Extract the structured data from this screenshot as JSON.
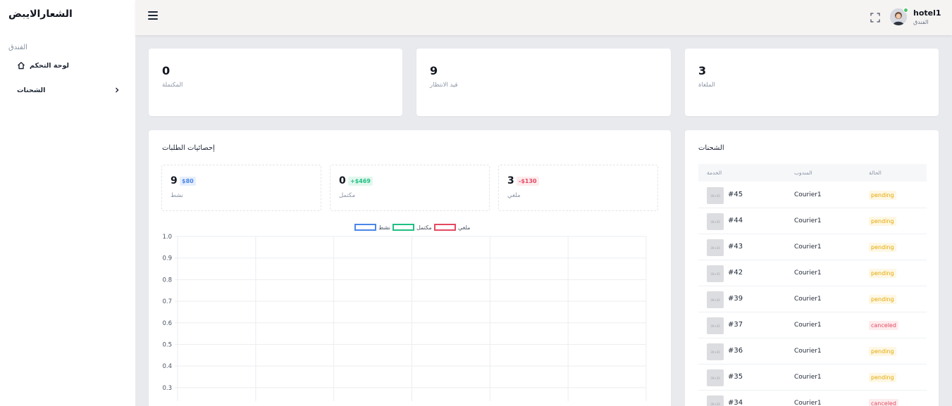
{
  "app": {
    "brand": "الشعارالايبض"
  },
  "sidebar": {
    "section_label": "الفندق",
    "items": [
      {
        "label": "لوحة التحكم",
        "icon": "home-icon"
      },
      {
        "label": "الشحنات",
        "icon": "chevron-right-icon"
      }
    ]
  },
  "header": {
    "user_name": "hotel1",
    "user_role": "الفندق"
  },
  "stats": [
    {
      "value": "0",
      "label": "المكتملة"
    },
    {
      "value": "9",
      "label": "قيد الانتظار"
    },
    {
      "value": "3",
      "label": "الملغاة"
    }
  ],
  "orders_panel": {
    "title": "إحصائيات الطلبات",
    "summary": [
      {
        "value": "9",
        "badge": "$80",
        "label": "نشط",
        "color": "#4a86e8"
      },
      {
        "value": "0",
        "badge": "+$469",
        "label": "مكتمل",
        "color": "#1fbf83"
      },
      {
        "value": "3",
        "badge": "-$130",
        "label": "ملغي",
        "color": "#e44961"
      }
    ]
  },
  "chart_data": {
    "type": "line",
    "legend_position": "top",
    "series": [
      {
        "name": "نشط",
        "color": "#4a86e8",
        "values": []
      },
      {
        "name": "مكتمل",
        "color": "#1fbf83",
        "values": []
      },
      {
        "name": "ملغي",
        "color": "#e44961",
        "values": []
      }
    ],
    "yticks": [
      "1.0",
      "0.9",
      "0.8",
      "0.7",
      "0.6",
      "0.5",
      "0.4",
      "0.3"
    ],
    "ylim": [
      0,
      1
    ],
    "grid": true
  },
  "shipments": {
    "title": "الشحنات",
    "columns": [
      "الخدمة",
      "المندوب",
      "الحالة"
    ],
    "thumb_text": "30×30",
    "rows": [
      {
        "id": "#45",
        "courier": "Courier1",
        "status": "pending"
      },
      {
        "id": "#44",
        "courier": "Courier1",
        "status": "pending"
      },
      {
        "id": "#43",
        "courier": "Courier1",
        "status": "pending"
      },
      {
        "id": "#42",
        "courier": "Courier1",
        "status": "pending"
      },
      {
        "id": "#39",
        "courier": "Courier1",
        "status": "pending"
      },
      {
        "id": "#37",
        "courier": "Courier1",
        "status": "canceled"
      },
      {
        "id": "#36",
        "courier": "Courier1",
        "status": "pending"
      },
      {
        "id": "#35",
        "courier": "Courier1",
        "status": "pending"
      },
      {
        "id": "#34",
        "courier": "Courier1",
        "status": "canceled"
      }
    ]
  }
}
